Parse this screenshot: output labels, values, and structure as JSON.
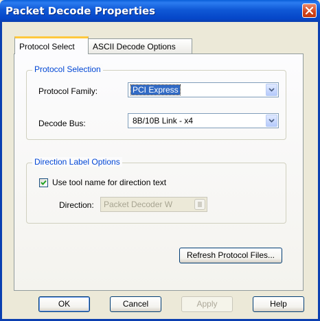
{
  "window": {
    "title": "Packet Decode Properties"
  },
  "tabs": [
    {
      "label": "Protocol Select",
      "active": true
    },
    {
      "label": "ASCII Decode Options",
      "active": false
    }
  ],
  "protocol_selection": {
    "group_title": "Protocol Selection",
    "family_label": "Protocol Family:",
    "family_value": "PCI Express",
    "bus_label": "Decode Bus:",
    "bus_value": "8B/10B Link - x4"
  },
  "direction_options": {
    "group_title": "Direction Label Options",
    "checkbox_label": "Use tool name for direction text",
    "checkbox_checked": true,
    "direction_label": "Direction:",
    "direction_value": "Packet Decoder W"
  },
  "refresh_button": "Refresh Protocol Files...",
  "footer_buttons": {
    "ok": "OK",
    "cancel": "Cancel",
    "apply": "Apply",
    "help": "Help"
  },
  "colors": {
    "title_bar": "#0b56d6",
    "group_title": "#0046d5",
    "tab_highlight": "#ffc83c",
    "selection": "#316ac5"
  }
}
